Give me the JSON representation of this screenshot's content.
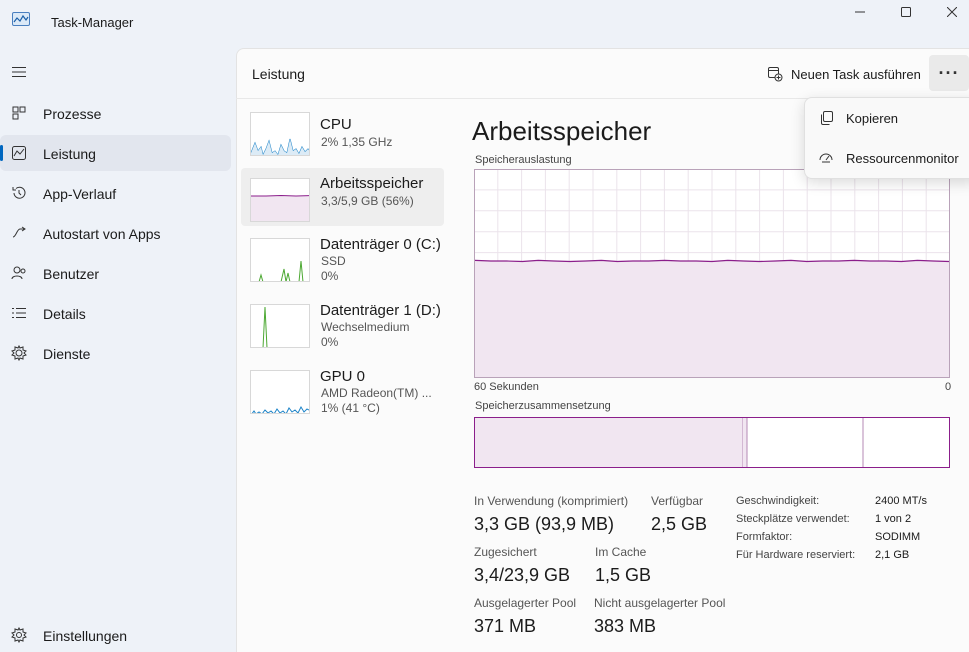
{
  "window": {
    "title": "Task-Manager",
    "icon": "task-manager-icon",
    "controls": [
      "minimize-icon",
      "maximize-icon",
      "close-icon"
    ]
  },
  "sidebar": {
    "items": [
      {
        "label": "Prozesse",
        "icon": "processes-icon"
      },
      {
        "label": "Leistung",
        "icon": "performance-icon",
        "active": true
      },
      {
        "label": "App-Verlauf",
        "icon": "history-icon"
      },
      {
        "label": "Autostart von Apps",
        "icon": "startup-icon"
      },
      {
        "label": "Benutzer",
        "icon": "users-icon"
      },
      {
        "label": "Details",
        "icon": "details-icon"
      },
      {
        "label": "Dienste",
        "icon": "services-icon"
      }
    ],
    "settings": {
      "label": "Einstellungen",
      "icon": "gear-icon"
    }
  },
  "header": {
    "title": "Leistung",
    "new_task_label": "Neuen Task ausführen",
    "more_label": "···"
  },
  "devices": [
    {
      "name": "CPU",
      "sub1": "2%  1,35 GHz",
      "sub2": "",
      "color": "#1b83c8"
    },
    {
      "name": "Arbeitsspeicher",
      "sub1": "3,3/5,9 GB (56%)",
      "sub2": "",
      "color": "#8b1e8b"
    },
    {
      "name": "Datenträger 0 (C:)",
      "sub1": "SSD",
      "sub2": "0%",
      "color": "#4ca832"
    },
    {
      "name": "Datenträger 1 (D:)",
      "sub1": "Wechselmedium",
      "sub2": "0%",
      "color": "#4ca832"
    },
    {
      "name": "GPU 0",
      "sub1": "AMD Radeon(TM) ...",
      "sub2": "1%  (41 °C)",
      "color": "#1b83c8"
    }
  ],
  "memory": {
    "title": "Arbeitsspeicher",
    "usage_label": "Speicherauslastung",
    "time_left": "60 Sekunden",
    "time_right": "0",
    "composition_label": "Speicherzusammensetzung",
    "usage_fraction": 0.56,
    "stats": {
      "in_use_label": "In Verwendung (komprimiert)",
      "in_use_value": "3,3 GB (93,9 MB)",
      "available_label": "Verfügbar",
      "available_value": "2,5 GB",
      "committed_label": "Zugesichert",
      "committed_value": "3,4/23,9 GB",
      "cached_label": "Im Cache",
      "cached_value": "1,5 GB",
      "paged_label": "Ausgelagerter Pool",
      "paged_value": "371 MB",
      "nonpaged_label": "Nicht ausgelagerter Pool",
      "nonpaged_value": "383 MB"
    },
    "details": [
      {
        "label": "Geschwindigkeit:",
        "value": "2400 MT/s"
      },
      {
        "label": "Steckplätze verwendet:",
        "value": "1 von 2"
      },
      {
        "label": "Formfaktor:",
        "value": "SODIMM"
      },
      {
        "label": "Für Hardware reserviert:",
        "value": "2,1 GB"
      }
    ]
  },
  "context_menu": {
    "items": [
      {
        "label": "Kopieren",
        "icon": "copy-icon"
      },
      {
        "label": "Ressourcenmonitor",
        "icon": "resource-monitor-icon"
      }
    ]
  },
  "colors": {
    "memory": "#8b1e8b",
    "memory_fill": "#f1e6f1",
    "accent": "#0067c0"
  }
}
